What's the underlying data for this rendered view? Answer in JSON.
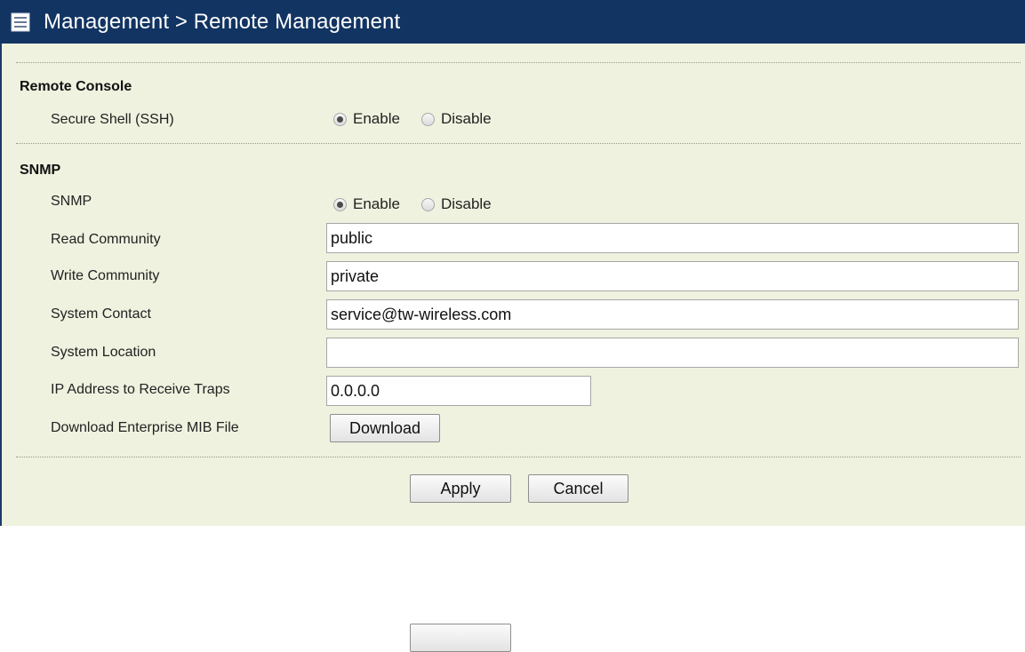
{
  "header": {
    "title": "Management > Remote Management",
    "icon": "menu-list-icon"
  },
  "remote_console": {
    "section_title": "Remote Console",
    "ssh": {
      "label": "Secure Shell (SSH)",
      "options": [
        "Enable",
        "Disable"
      ],
      "selected": "Enable"
    }
  },
  "snmp": {
    "section_title": "SNMP",
    "snmp_toggle": {
      "label": "SNMP",
      "options": [
        "Enable",
        "Disable"
      ],
      "selected": "Enable"
    },
    "read_community": {
      "label": "Read Community",
      "value": "public"
    },
    "write_community": {
      "label": "Write Community",
      "value": "private"
    },
    "system_contact": {
      "label": "System Contact",
      "value": "service@tw-wireless.com"
    },
    "system_location": {
      "label": "System Location",
      "value": ""
    },
    "trap_ip": {
      "label": "IP Address to Receive Traps",
      "value": "0.0.0.0"
    },
    "mib_download": {
      "label": "Download Enterprise MIB File",
      "button_label": "Download"
    }
  },
  "footer": {
    "apply_label": "Apply",
    "cancel_label": "Cancel"
  },
  "colors": {
    "header_bg": "#123462",
    "panel_bg": "#eef2df",
    "header_text": "#ffffff"
  }
}
